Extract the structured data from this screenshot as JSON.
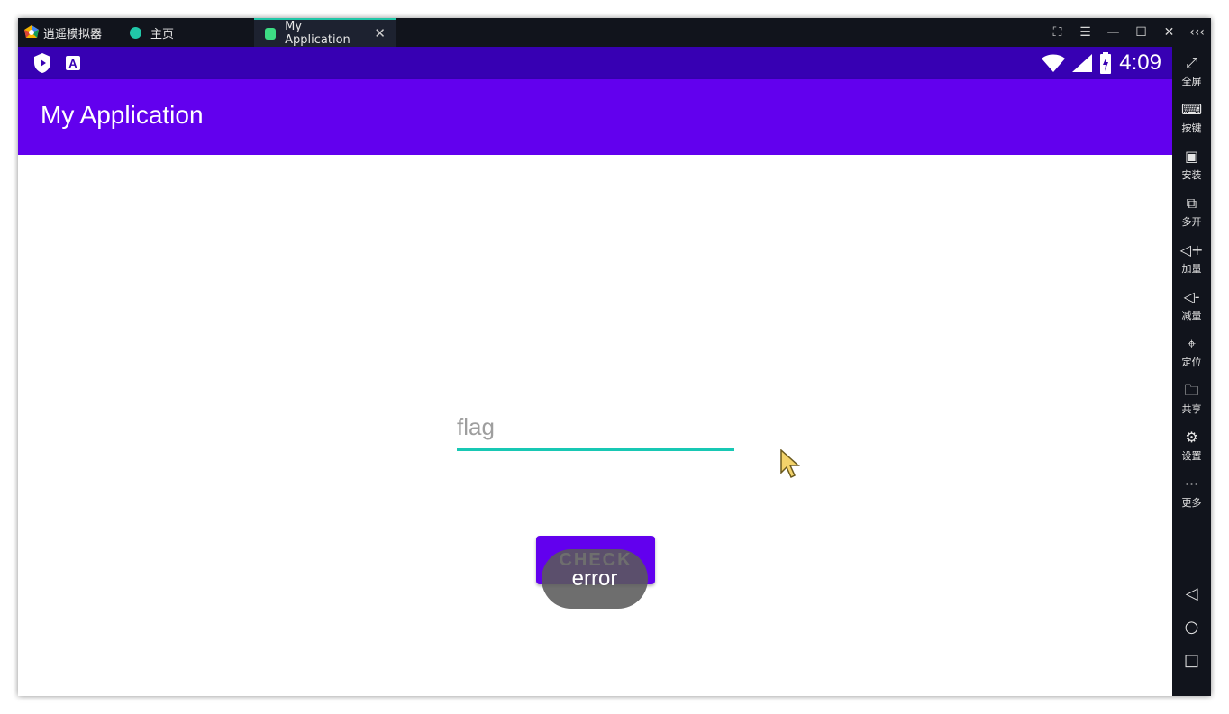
{
  "titlebar": {
    "brand": "逍遥模拟器",
    "tabs": [
      {
        "label": "主页",
        "icon": "home-app-icon"
      },
      {
        "label": "My Application",
        "icon": "android-app-icon"
      }
    ],
    "controls": {
      "screenshot": "⛶",
      "menu": "☰",
      "minimize": "—",
      "maximize": "☐",
      "close": "✕",
      "collapse": "‹‹‹"
    }
  },
  "statusbar": {
    "time": "4:09"
  },
  "app": {
    "title": "My Application",
    "input_placeholder": "flag",
    "check_label": "CHECK",
    "toast": "error"
  },
  "sidebar": {
    "items": [
      {
        "label": "全屏",
        "icon": "fullscreen-icon",
        "glyph": "⤢"
      },
      {
        "label": "按键",
        "icon": "keyboard-icon",
        "glyph": "⌨"
      },
      {
        "label": "安装",
        "icon": "apk-icon",
        "glyph": "▣"
      },
      {
        "label": "多开",
        "icon": "multi-instance-icon",
        "glyph": "⧉"
      },
      {
        "label": "加量",
        "icon": "volume-up-icon",
        "glyph": "◁+"
      },
      {
        "label": "减量",
        "icon": "volume-down-icon",
        "glyph": "◁-"
      },
      {
        "label": "定位",
        "icon": "location-icon",
        "glyph": "⌖"
      },
      {
        "label": "共享",
        "icon": "folder-icon",
        "glyph": "🗀"
      },
      {
        "label": "设置",
        "icon": "gear-icon",
        "glyph": "⚙"
      },
      {
        "label": "更多",
        "icon": "more-icon",
        "glyph": "···"
      }
    ],
    "nav": {
      "back": "◁",
      "home": "○",
      "recents": "□"
    }
  },
  "colors": {
    "statusbar": "#3700b3",
    "appbar": "#6200ee",
    "accent": "#18c8b4",
    "chrome": "#11141c"
  }
}
